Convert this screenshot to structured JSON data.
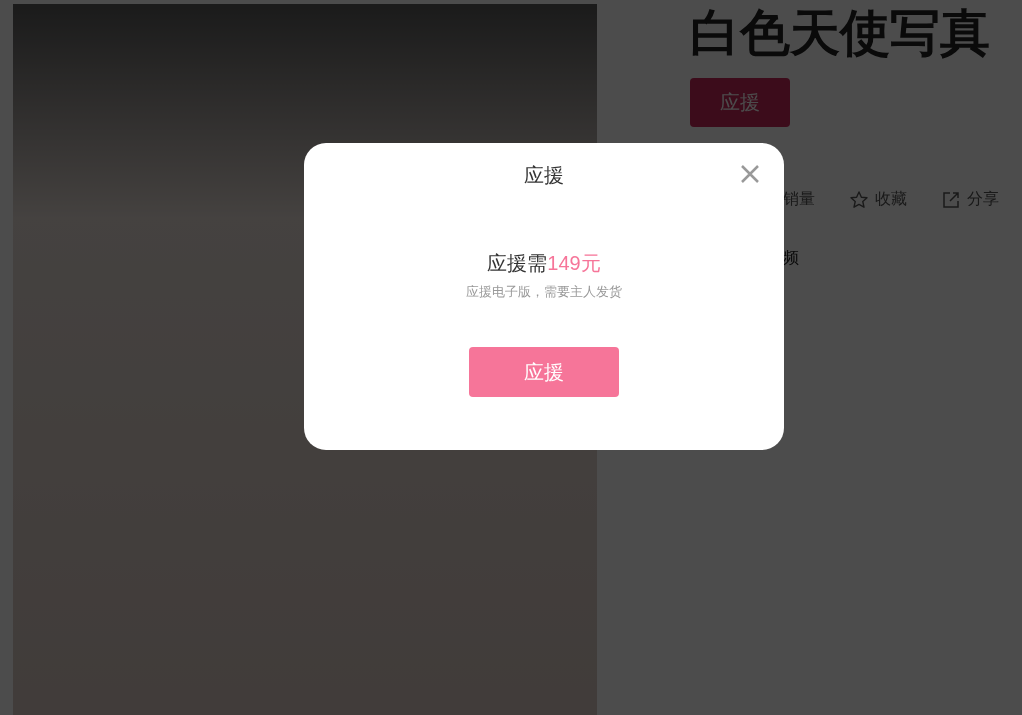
{
  "product": {
    "title": "白色天使写真",
    "support_button": "应援",
    "actions": [
      {
        "kind": "sales",
        "label": "销量"
      },
      {
        "kind": "favorite",
        "label": "收藏"
      },
      {
        "kind": "share",
        "label": "分享"
      }
    ],
    "detail_fragment": "频"
  },
  "dialog": {
    "title": "应援",
    "price_prefix": "应援需",
    "price": "149元",
    "note": "应援电子版，需要主人发货",
    "confirm_button": "应援"
  }
}
